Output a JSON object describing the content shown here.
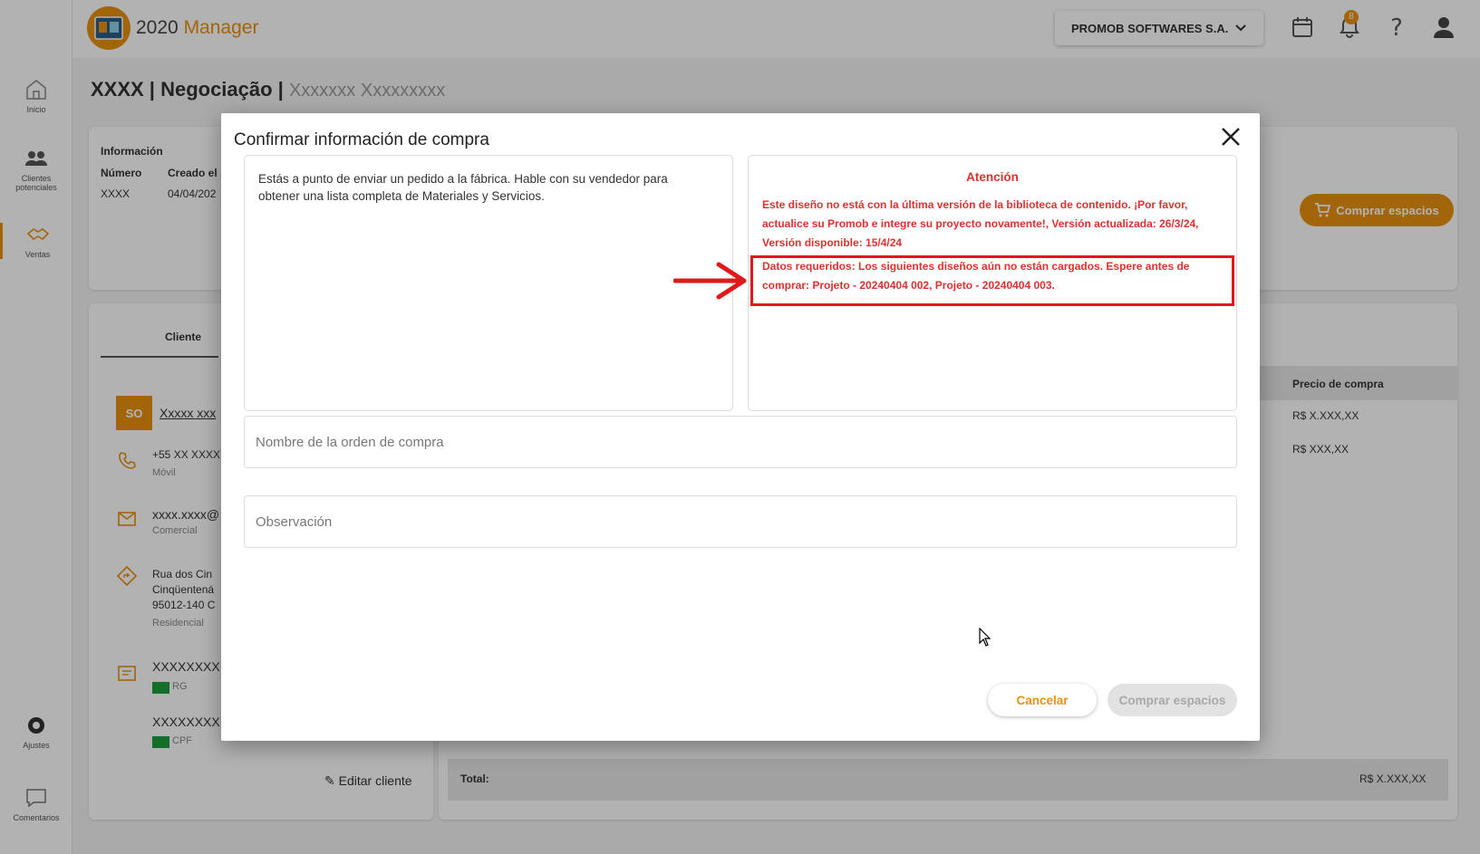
{
  "app": {
    "brand": "2020",
    "product": "Manager",
    "company": "PROMOB SOFTWARES S.A.",
    "notifications_count": "8",
    "colors": {
      "accent": "#e8910f",
      "danger": "#e03131",
      "highlight": "#e01a1a"
    },
    "sidebar": [
      {
        "label": "Inicio",
        "icon": "home-icon"
      },
      {
        "label": "Clientes potenciales",
        "icon": "users-icon"
      },
      {
        "label": "Ventas",
        "icon": "handshake-icon"
      },
      {
        "label": "Ajustes",
        "icon": "gear-icon"
      },
      {
        "label": "Comentarios",
        "icon": "chat-icon"
      }
    ]
  },
  "page": {
    "title": "XXXX | Negociação |",
    "subtitle": "Xxxxxxx Xxxxxxxxx",
    "info_heading": "Información",
    "number_label": "Número",
    "number_value": "XXXX",
    "created_label": "Creado el",
    "created_value": "04/04/202",
    "buy_button": "Comprar espacios",
    "client_tab": "Cliente",
    "avatar": "SO",
    "client_name": "Xxxxx xxx",
    "phone": "+55 XX XXXX",
    "phone_type": "Móvil",
    "email": "xxxx.xxxx@",
    "email_type": "Comercial",
    "address_1": "Rua dos Cin",
    "address_2": "Cinqüentená",
    "address_3": "95012-140 C",
    "address_type": "Residencial",
    "doc_1": "XXXXXXXX",
    "doc_1_type": "RG",
    "doc_2": "XXXXXXXX",
    "doc_2_type": "CPF",
    "edit_client": "Editar cliente",
    "price_header": "Precio de compra",
    "price_1": "R$ X.XXX,XX",
    "price_2": "R$ XXX,XX",
    "total_label": "Total:",
    "total_value": "R$ X.XXX,XX"
  },
  "modal": {
    "title": "Confirmar información de compra",
    "info": "Estás a punto de enviar un pedido a la fábrica. Hable con su vendedor para obtener una lista completa de Materiales y Servicios.",
    "attention_title": "Atención",
    "attention_1": "Este diseño no está con la última versión de la biblioteca de contenido. ¡Por favor, actualice su Promob e integre su proyecto novamente!, Versión actualizada: 26/3/24, Versión disponible: 15/4/24",
    "attention_2": "Datos requeridos: Los siguientes diseños aún no están cargados. Espere antes de comprar: Projeto - 20240404 002, Projeto - 20240404 003.",
    "order_name_placeholder": "Nombre de la orden de compra",
    "observation_placeholder": "Observación",
    "cancel_label": "Cancelar",
    "buy_label": "Comprar espacios"
  }
}
